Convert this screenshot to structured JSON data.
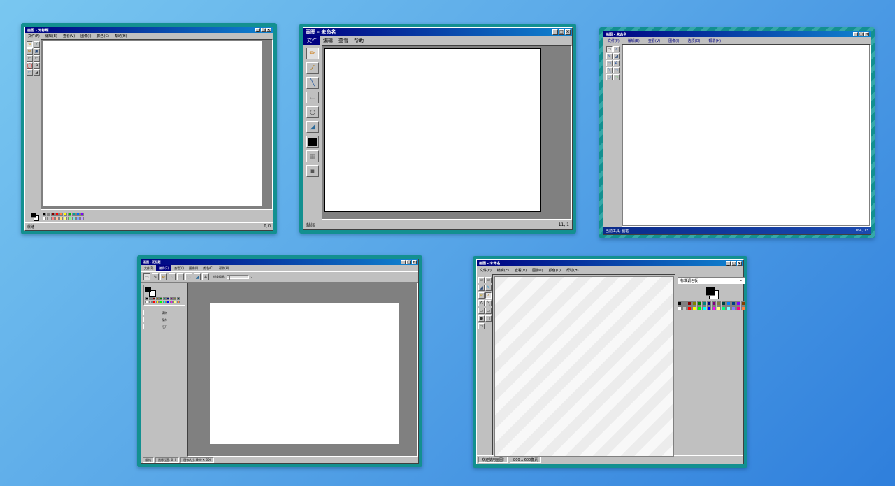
{
  "w1": {
    "title": "画图 - 无标题",
    "menu": [
      "文件(F)",
      "编辑(E)",
      "查看(V)",
      "图像(I)",
      "颜色(C)",
      "帮助(H)"
    ],
    "tools": [
      "✎",
      "⁄",
      "✏",
      "▣",
      "▭",
      "▭",
      "◯",
      "A",
      "▭",
      "◢"
    ],
    "status_left": "就绪",
    "status_right": "0, 0",
    "palette": [
      "#000000",
      "#808080",
      "#800000",
      "#ff0000",
      "#ff8040",
      "#ffff00",
      "#00c000",
      "#00a0a0",
      "#0070ff",
      "#8000ff",
      "#ffffff",
      "#c0c0c0",
      "#ff8080",
      "#ffc0a0",
      "#ffe080",
      "#ffff80",
      "#80ff80",
      "#80e0e0",
      "#80a0ff",
      "#c0a0ff"
    ]
  },
  "w2": {
    "title": "画图 – 未命名",
    "menu": [
      "文件",
      "编辑",
      "查看",
      "帮助"
    ],
    "tools": [
      "✏",
      "⁄",
      "╲",
      "▭",
      "○",
      "◢",
      "",
      "▦",
      "▣"
    ],
    "status_left": "就绪",
    "status_right": "11, 1"
  },
  "w3": {
    "title": "画图 - 未命名",
    "menu": [
      "文件(F)",
      "编辑(E)",
      "查看(V)",
      "图像(I)",
      "选项(O)",
      "帮助(H)"
    ],
    "tools": [
      "▭",
      "⁄",
      "✎",
      "◢",
      "▭",
      "A",
      "╲",
      "▭",
      "○",
      "▭"
    ],
    "status_left": "当前工具: 铅笔",
    "status_right": "164, 13"
  },
  "w4": {
    "title": "画图 - 无标题",
    "menu": [
      "文件(F)",
      "编辑(E)",
      "查看(V)",
      "图像(I)",
      "颜色(C)",
      "帮助(H)"
    ],
    "tools": [
      "▭",
      "✎",
      "✏",
      "╲",
      "▭",
      "○",
      "◢",
      "A"
    ],
    "linewidth_label": "线条粗细:",
    "linewidth_value": "2",
    "buttons": [
      "清除",
      "保存",
      "打开"
    ],
    "status": [
      "就绪",
      "鼠标位置: 0, 0",
      "画布大小: 800 × 600"
    ],
    "palette": [
      "#000000",
      "#808080",
      "#800000",
      "#808000",
      "#008000",
      "#008080",
      "#000080",
      "#800080",
      "#808040",
      "#004040",
      "#ffffff",
      "#c0c0c0",
      "#ff0000",
      "#ffff00",
      "#00ff00",
      "#00ffff",
      "#0000ff",
      "#ff00ff",
      "#ffff80",
      "#ff8040"
    ]
  },
  "w5": {
    "title": "画图 - 未命名",
    "menu": [
      "文件(F)",
      "编辑(E)",
      "查看(V)",
      "图像(I)",
      "颜色(C)",
      "帮助(H)"
    ],
    "tools": [
      "▭",
      "▭",
      "◢",
      "✎",
      "✏",
      "⁄",
      "A",
      "╲",
      "▭",
      "▭",
      "●",
      "○",
      "▭"
    ],
    "palette_select": "标准调色板",
    "status_left": "欢迎使用画图!",
    "status_size": "800 x 600像素",
    "palette": [
      "#000000",
      "#808080",
      "#800000",
      "#808000",
      "#008000",
      "#008080",
      "#000080",
      "#800080",
      "#808040",
      "#004040",
      "#0080ff",
      "#004080",
      "#8000ff",
      "#804000",
      "#ffffff",
      "#c0c0c0",
      "#ff0000",
      "#ffff00",
      "#00ff00",
      "#00ffff",
      "#0000ff",
      "#ff00ff",
      "#ffff80",
      "#00ff80",
      "#80ffff",
      "#8080ff",
      "#ff0080",
      "#ff8040"
    ]
  }
}
